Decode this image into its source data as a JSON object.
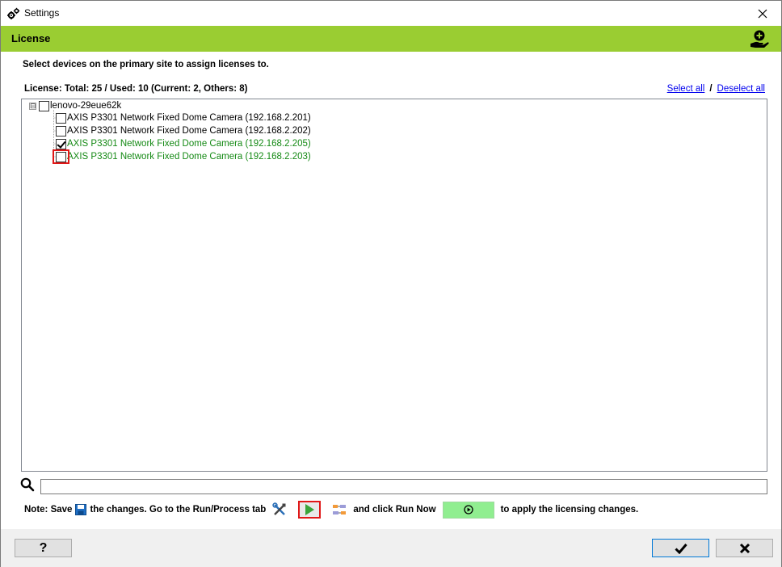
{
  "window": {
    "title": "Settings",
    "icons": {
      "app": "gears-icon",
      "close": "close-icon"
    }
  },
  "header": {
    "section_title": "License",
    "icon": "license-hand-plus-icon",
    "band_color": "#9acd32"
  },
  "instruction": "Select devices on the primary site to assign licenses to.",
  "license_summary": "License: Total: 25 / Used: 10 (Current: 2, Others: 8)",
  "links": {
    "select_all": "Select all",
    "separator": "/",
    "deselect_all": "Deselect all"
  },
  "tree": {
    "root": {
      "label": "lenovo-29eue62k",
      "expanded": true,
      "checked": false,
      "expander": "⊟"
    },
    "items": [
      {
        "label": "AXIS P3301 Network Fixed Dome Camera (192.168.2.201)",
        "checked": false,
        "licensed": false
      },
      {
        "label": "AXIS P3301 Network Fixed Dome Camera (192.168.2.202)",
        "checked": false,
        "licensed": false
      },
      {
        "label": "AXIS P3301 Network Fixed Dome Camera (192.168.2.205)",
        "checked": true,
        "licensed": true
      },
      {
        "label": "AXIS P3301 Network Fixed Dome Camera (192.168.2.203)",
        "checked": false,
        "licensed": true,
        "highlighted": true
      }
    ],
    "licensed_color": "#158a15"
  },
  "search": {
    "value": "",
    "placeholder": "",
    "icon": "search-icon"
  },
  "note": {
    "part1": "Note: Save",
    "part2": "the changes. Go to the Run/Process tab",
    "part3": "and click Run Now",
    "part4": "to apply the licensing changes.",
    "icons": [
      "save-icon",
      "tools-icon",
      "play-icon",
      "process-icon",
      "run-now-icon"
    ]
  },
  "footer": {
    "help_label": "?",
    "ok_icon": "checkmark-icon",
    "cancel_icon": "x-icon"
  },
  "colors": {
    "highlight": "#e01818",
    "run_now_bg": "#90ee90",
    "link": "#0000ee"
  }
}
